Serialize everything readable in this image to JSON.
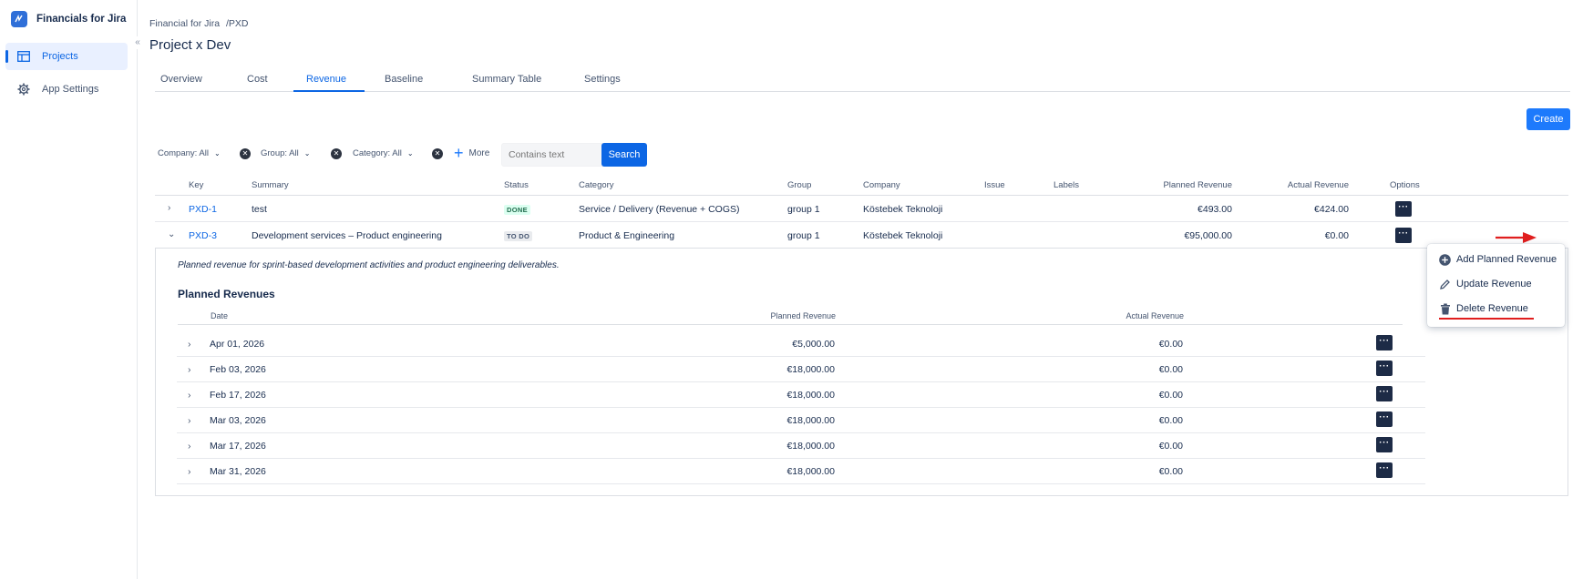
{
  "app": {
    "title": "Financials for Jira",
    "collapse_glyph": "«"
  },
  "sidebar": {
    "items": [
      {
        "label": "Projects",
        "icon": "projects-icon",
        "active": true
      },
      {
        "label": "App Settings",
        "icon": "gear-icon",
        "active": false
      }
    ]
  },
  "breadcrumb": {
    "root": "Financial for Jira",
    "sep": "/",
    "project": "PXD"
  },
  "page": {
    "title": "Project x Dev"
  },
  "tabs": [
    {
      "label": "Overview"
    },
    {
      "label": "Cost"
    },
    {
      "label": "Revenue",
      "active": true
    },
    {
      "label": "Baseline"
    },
    {
      "label": "Summary Table"
    },
    {
      "label": "Settings"
    }
  ],
  "toolbar": {
    "create_label": "Create"
  },
  "filters": {
    "company": "Company: All",
    "group": "Group: All",
    "category": "Category: All",
    "more_label": "More",
    "search_placeholder": "Contains text",
    "search_label": "Search"
  },
  "table": {
    "headers": {
      "key": "Key",
      "summary": "Summary",
      "status": "Status",
      "category": "Category",
      "group": "Group",
      "company": "Company",
      "issue": "Issue",
      "labels": "Labels",
      "planned": "Planned Revenue",
      "actual": "Actual Revenue",
      "options": "Options"
    },
    "rows": [
      {
        "key": "PXD-1",
        "summary": "test",
        "status": "DONE",
        "category": "Service / Delivery (Revenue + COGS)",
        "group": "group 1",
        "company": "Köstebek Teknoloji",
        "planned": "€493.00",
        "actual": "€424.00",
        "expander": "›"
      },
      {
        "key": "PXD-3",
        "summary": "Development services – Product engineering",
        "status": "TO DO",
        "category": "Product & Engineering",
        "group": "group 1",
        "company": "Köstebek Teknoloji",
        "planned": "€95,000.00",
        "actual": "€0.00",
        "expander": "⌄"
      }
    ]
  },
  "details": {
    "description": "Planned revenue for sprint-based development activities and product engineering deliverables.",
    "title": "Planned Revenues",
    "headers": {
      "date": "Date",
      "planned": "Planned Revenue",
      "actual": "Actual Revenue"
    },
    "rows": [
      {
        "date": "Apr 01, 2026",
        "planned": "€5,000.00",
        "actual": "€0.00"
      },
      {
        "date": "Feb 03, 2026",
        "planned": "€18,000.00",
        "actual": "€0.00"
      },
      {
        "date": "Feb 17, 2026",
        "planned": "€18,000.00",
        "actual": "€0.00"
      },
      {
        "date": "Mar 03, 2026",
        "planned": "€18,000.00",
        "actual": "€0.00"
      },
      {
        "date": "Mar 17, 2026",
        "planned": "€18,000.00",
        "actual": "€0.00"
      },
      {
        "date": "Mar 31, 2026",
        "planned": "€18,000.00",
        "actual": "€0.00"
      }
    ]
  },
  "menu": {
    "items": [
      {
        "label": "Add Planned Revenue",
        "icon": "add-circle-icon"
      },
      {
        "label": "Update Revenue",
        "icon": "pencil-icon"
      },
      {
        "label": "Delete Revenue",
        "icon": "trash-icon"
      }
    ]
  },
  "ui": {
    "options_glyph": "···",
    "chev_glyph": "⌄",
    "clear_glyph": "✕",
    "plus_glyph": "+",
    "row_expander_glyph": "›"
  },
  "colors": {
    "accent": "#0c66e4",
    "button": "#1d7afc",
    "annotation": "#e01e1e",
    "options_btn": "#1d2b46"
  }
}
